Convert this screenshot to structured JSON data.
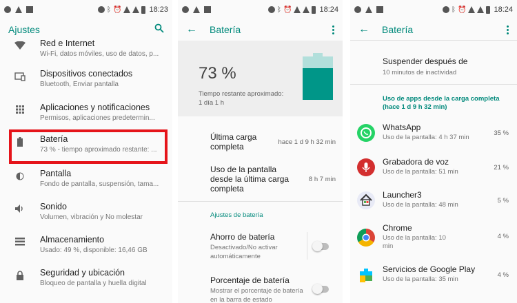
{
  "status": {
    "time_1": "18:23",
    "time_2": "18:24",
    "time_3": "18:24"
  },
  "screen1": {
    "title": "Ajustes",
    "items": [
      {
        "title": "Red e Internet",
        "subtitle": "Wi-Fi, datos móviles, uso de datos, p..."
      },
      {
        "title": "Dispositivos conectados",
        "subtitle": "Bluetooth, Enviar pantalla"
      },
      {
        "title": "Aplicaciones y notificaciones",
        "subtitle": "Permisos, aplicaciones predetermin..."
      },
      {
        "title": "Batería",
        "subtitle": "73 % - tiempo aproximado restante: ..."
      },
      {
        "title": "Pantalla",
        "subtitle": "Fondo de pantalla, suspensión, tama..."
      },
      {
        "title": "Sonido",
        "subtitle": "Volumen, vibración y No molestar"
      },
      {
        "title": "Almacenamiento",
        "subtitle": "Usado: 49 %, disponible: 16,46 GB"
      },
      {
        "title": "Seguridad y ubicación",
        "subtitle": "Bloqueo de pantalla y huella digital"
      }
    ]
  },
  "screen2": {
    "title": "Batería",
    "battery_level": 73,
    "percent_text": "73 %",
    "remaining_label": "Tiempo restante aproximado:",
    "remaining_value": "1 día 1 h",
    "last_charge_label": "Última carga completa",
    "last_charge_value": "hace 1 d 9 h 32 min",
    "screen_usage_label": "Uso de la pantalla desde la última carga completa",
    "screen_usage_value": "8 h 7 min",
    "settings_section": "Ajustes de batería",
    "saver_title": "Ahorro de batería",
    "saver_sub": "Desactivado/No activar automáticamente",
    "percentage_title": "Porcentaje de batería",
    "percentage_sub": "Mostrar el porcentaje de batería en la barra de estado"
  },
  "screen3": {
    "title": "Batería",
    "sleep_title": "Suspender después de",
    "sleep_sub": "10 minutos de inactividad",
    "section": "Uso de apps desde la carga completa (hace 1 d 9 h 32 min)",
    "apps": [
      {
        "name": "WhatsApp",
        "usage": "Uso de la pantalla: 4 h 37 min",
        "pct": "35 %",
        "color": "#25d366"
      },
      {
        "name": "Grabadora de voz",
        "usage": "Uso de la pantalla: 51 min",
        "pct": "21 %",
        "color": "#d32f2f"
      },
      {
        "name": "Launcher3",
        "usage": "Uso de la pantalla: 48 min",
        "pct": "5 %",
        "color": "#e8eaf6"
      },
      {
        "name": "Chrome",
        "usage": "Uso de la pantalla: 10 min",
        "pct": "4 %",
        "color": "#db4437"
      },
      {
        "name": "Servicios de Google Play",
        "usage": "Uso de la pantalla: 35 min",
        "pct": "4 %",
        "color": "#00c4ff"
      }
    ]
  }
}
